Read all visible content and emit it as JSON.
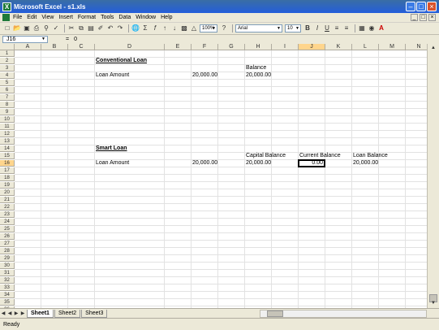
{
  "window": {
    "title": "Microsoft Excel - s1.xls",
    "app_icon": "X"
  },
  "menu": [
    "File",
    "Edit",
    "View",
    "Insert",
    "Format",
    "Tools",
    "Data",
    "Window",
    "Help"
  ],
  "toolbar": {
    "zoom": "100%",
    "font_name": "Arial",
    "font_size": "10"
  },
  "formula_bar": {
    "cell_ref": "J16",
    "fx_label": "=",
    "value": "0"
  },
  "columns": [
    "A",
    "B",
    "C",
    "D",
    "E",
    "F",
    "G",
    "H",
    "I",
    "J",
    "K",
    "L",
    "M",
    "N"
  ],
  "rows": [
    "1",
    "2",
    "3",
    "4",
    "5",
    "6",
    "7",
    "8",
    "9",
    "10",
    "11",
    "12",
    "13",
    "14",
    "15",
    "16",
    "17",
    "18",
    "19",
    "20",
    "21",
    "22",
    "23",
    "24",
    "25",
    "26",
    "27",
    "28",
    "29",
    "30",
    "31",
    "32",
    "33",
    "34",
    "35",
    "36"
  ],
  "active_cell": {
    "col": "J",
    "row": "16"
  },
  "cells": {
    "D2": "Conventional Loan",
    "H3": "Balance",
    "D4": "Loan Amount",
    "F4": "20,000.00",
    "H4": "20,000.00",
    "D14": "Smart Loan",
    "H15": "Capital Balance",
    "J15": "Current Balance",
    "L15": "Loan Balance",
    "D16": "Loan Amount",
    "F16": "20,000.00",
    "H16": "20,000.00",
    "J16": "0.00",
    "L16": "20,000.00"
  },
  "sheets": [
    "Sheet1",
    "Sheet2",
    "Sheet3"
  ],
  "active_sheet": "Sheet1",
  "status": "Ready"
}
